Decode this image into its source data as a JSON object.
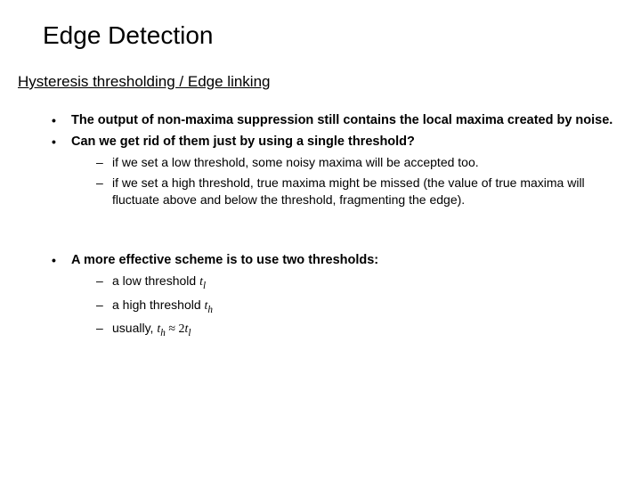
{
  "title": "Edge Detection",
  "subtitle": "Hysteresis thresholding / Edge linking",
  "bullets": {
    "b1": "The output of non-maxima suppression still contains the local maxima created by noise.",
    "b2": "Can we get rid of them just by using a single threshold?",
    "b2_sub1": "if we set a low threshold, some noisy maxima will be accepted too.",
    "b2_sub2": "if we set a high threshold, true maxima might be missed (the value of true maxima will fluctuate above and below the threshold, fragmenting the edge).",
    "b3": "A more effective scheme is to use two thresholds:",
    "b3_sub1_prefix": "a low threshold ",
    "b3_sub1_sym": "t",
    "b3_sub1_subscript": "l",
    "b3_sub2_prefix": "a high threshold ",
    "b3_sub2_sym": "t",
    "b3_sub2_subscript": "h",
    "b3_sub3_prefix": "usually, ",
    "b3_sub3_th": "t",
    "b3_sub3_th_sub": "h",
    "b3_sub3_approx": " ≈ ",
    "b3_sub3_two": "2",
    "b3_sub3_tl": "t",
    "b3_sub3_tl_sub": "l"
  }
}
